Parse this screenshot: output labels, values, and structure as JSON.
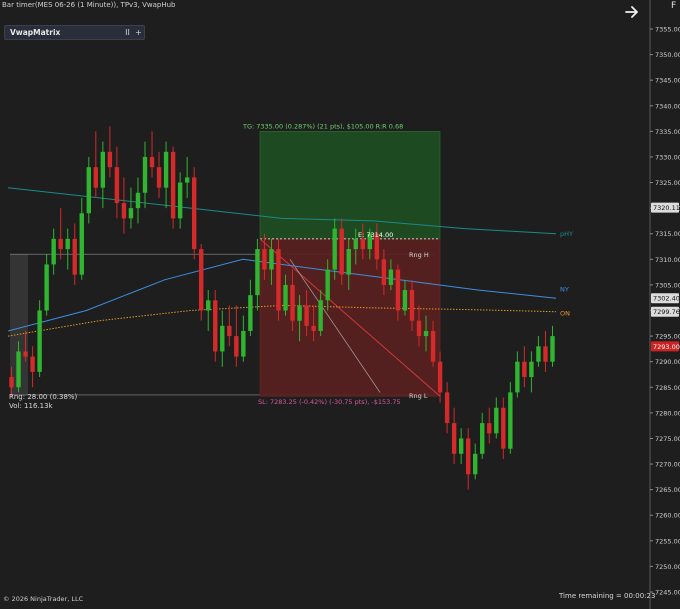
{
  "header": {
    "title": "Bar timer(MES 06-26 (1 Minute)), TPv3, VwapHub"
  },
  "panel": {
    "title": "VwapMatrix",
    "pause_label": "II",
    "add_label": "+"
  },
  "toolbar": {
    "arrow_icon": "arrow-right-icon",
    "f_label": "F"
  },
  "info": {
    "range": "Rng: 28.00 (0.38%)",
    "volume": "Vol: 116.13k"
  },
  "footer": {
    "copyright": "© 2026 NinjaTrader, LLC",
    "time_remaining": "Time remaining = 00:00:23"
  },
  "chart_data": {
    "type": "candlestick",
    "symbol": "MES 06-26",
    "interval": "1 Minute",
    "ylim": [
      7240,
      7360
    ],
    "ticks": [
      7245,
      7250,
      7255,
      7260,
      7265,
      7270,
      7275,
      7280,
      7285,
      7290,
      7295,
      7300,
      7305,
      7310,
      7315,
      7320,
      7325,
      7330,
      7335,
      7340,
      7345,
      7350,
      7355
    ],
    "tick_labels": [
      "7245.00",
      "7250.00",
      "7255.00",
      "7260.00",
      "7265.00",
      "7270.00",
      "7275.00",
      "7280.00",
      "7285.00",
      "7290.00",
      "7295.00",
      "7300.00",
      "7305.00",
      "7310.00",
      "7315.00",
      "7320.00",
      "7325.00",
      "7330.00",
      "7335.00",
      "7340.00",
      "7345.00",
      "7350.00",
      "7355.00"
    ],
    "colors": {
      "up": "#2fb52f",
      "down": "#d42a2a",
      "target": "#1f4d23",
      "stop": "#5a1f1f"
    },
    "candles": [
      [
        7287,
        7289,
        7283,
        7285
      ],
      [
        7285,
        7294,
        7284,
        7292
      ],
      [
        7292,
        7296,
        7290,
        7291
      ],
      [
        7291,
        7293,
        7285,
        7288
      ],
      [
        7288,
        7302,
        7287,
        7300
      ],
      [
        7300,
        7311,
        7299,
        7309
      ],
      [
        7309,
        7316,
        7307,
        7314
      ],
      [
        7314,
        7320,
        7310,
        7312
      ],
      [
        7312,
        7316,
        7308,
        7314
      ],
      [
        7314,
        7317,
        7305,
        7307
      ],
      [
        7307,
        7322,
        7306,
        7319
      ],
      [
        7319,
        7330,
        7317,
        7328
      ],
      [
        7328,
        7335,
        7322,
        7324
      ],
      [
        7324,
        7333,
        7320,
        7331
      ],
      [
        7331,
        7336,
        7326,
        7328
      ],
      [
        7328,
        7332,
        7318,
        7321
      ],
      [
        7321,
        7326,
        7315,
        7318
      ],
      [
        7318,
        7324,
        7316,
        7320
      ],
      [
        7320,
        7326,
        7317,
        7323
      ],
      [
        7323,
        7333,
        7320,
        7330
      ],
      [
        7330,
        7335,
        7326,
        7328
      ],
      [
        7328,
        7331,
        7322,
        7324
      ],
      [
        7324,
        7333,
        7320,
        7331
      ],
      [
        7331,
        7332,
        7316,
        7318
      ],
      [
        7318,
        7327,
        7316,
        7325
      ],
      [
        7325,
        7330,
        7322,
        7326
      ],
      [
        7326,
        7328,
        7310,
        7312
      ],
      [
        7312,
        7313,
        7298,
        7300
      ],
      [
        7300,
        7304,
        7296,
        7302
      ],
      [
        7302,
        7304,
        7290,
        7292
      ],
      [
        7292,
        7300,
        7289,
        7297
      ],
      [
        7297,
        7301,
        7293,
        7295
      ],
      [
        7295,
        7301,
        7289,
        7291
      ],
      [
        7291,
        7299,
        7290,
        7296
      ],
      [
        7296,
        7306,
        7295,
        7303
      ],
      [
        7303,
        7314,
        7300,
        7312
      ],
      [
        7312,
        7315,
        7306,
        7308
      ],
      [
        7308,
        7314,
        7305,
        7312
      ],
      [
        7312,
        7314,
        7298,
        7300
      ],
      [
        7300,
        7307,
        7299,
        7305
      ],
      [
        7305,
        7308,
        7296,
        7298
      ],
      [
        7298,
        7303,
        7294,
        7301
      ],
      [
        7301,
        7304,
        7295,
        7297
      ],
      [
        7297,
        7301,
        7294,
        7296
      ],
      [
        7296,
        7304,
        7295,
        7302
      ],
      [
        7302,
        7310,
        7300,
        7308
      ],
      [
        7308,
        7318,
        7306,
        7316
      ],
      [
        7316,
        7318,
        7305,
        7307
      ],
      [
        7307,
        7314,
        7304,
        7312
      ],
      [
        7312,
        7316,
        7309,
        7314
      ],
      [
        7314,
        7317,
        7310,
        7312
      ],
      [
        7312,
        7316,
        7310,
        7315
      ],
      [
        7315,
        7317,
        7308,
        7310
      ],
      [
        7310,
        7312,
        7303,
        7305
      ],
      [
        7305,
        7310,
        7304,
        7308
      ],
      [
        7308,
        7309,
        7298,
        7300
      ],
      [
        7300,
        7306,
        7299,
        7304
      ],
      [
        7304,
        7306,
        7296,
        7298
      ],
      [
        7298,
        7301,
        7293,
        7295
      ],
      [
        7295,
        7299,
        7292,
        7296
      ],
      [
        7296,
        7298,
        7289,
        7290
      ],
      [
        7290,
        7292,
        7282,
        7284
      ],
      [
        7284,
        7286,
        7276,
        7278
      ],
      [
        7278,
        7281,
        7270,
        7272
      ],
      [
        7272,
        7277,
        7270,
        7275
      ],
      [
        7275,
        7277,
        7265,
        7268
      ],
      [
        7268,
        7274,
        7267,
        7272
      ],
      [
        7272,
        7280,
        7271,
        7278
      ],
      [
        7278,
        7281,
        7274,
        7276
      ],
      [
        7276,
        7283,
        7275,
        7281
      ],
      [
        7281,
        7283,
        7271,
        7273
      ],
      [
        7273,
        7286,
        7272,
        7284
      ],
      [
        7284,
        7292,
        7283,
        7290
      ],
      [
        7290,
        7293,
        7285,
        7287
      ],
      [
        7287,
        7292,
        7284,
        7290
      ],
      [
        7290,
        7295,
        7289,
        7293
      ],
      [
        7293,
        7296,
        7288,
        7290
      ],
      [
        7290,
        7297,
        7289,
        7295
      ]
    ],
    "lines": [
      {
        "name": "pHY",
        "color": "#1b8a8a",
        "values": [
          7324,
          7322,
          7320,
          7318,
          7317.5,
          7316,
          7315
        ]
      },
      {
        "name": "NY",
        "color": "#3d8fe0",
        "values": [
          7296,
          7300,
          7306,
          7310,
          7308,
          7306,
          7304,
          7302.4
        ]
      },
      {
        "name": "ON",
        "color": "#e09a2a",
        "values": [
          7295,
          7298,
          7300,
          7301,
          7300.5,
          7300.2,
          7299.76
        ]
      }
    ],
    "price_labels": [
      {
        "label": "7320.11",
        "value": 7320.11,
        "bg": "#dcdcdc",
        "fg": "#111111"
      },
      {
        "label": "7302.40",
        "value": 7302.4,
        "bg": "#dcdcdc",
        "fg": "#111111"
      },
      {
        "label": "7299.76",
        "value": 7299.76,
        "bg": "#dcdcdc",
        "fg": "#111111"
      },
      {
        "label": "7293.00",
        "value": 7293.0,
        "bg": "#cc2222",
        "fg": "#ffffff"
      }
    ],
    "annotations": {
      "target_text": "TG: 7335.00 (0.287%) (21 pts), $105.00  R:R 0.68",
      "entry_text": "E: 7314.00",
      "stop_text": "SL: 7283.25 (-0.42%) (-30.75 pts), -$153.75",
      "range_high": "Rng H",
      "range_low": "Rng L",
      "line_labels": [
        "pHY",
        "NY",
        "ON"
      ],
      "target_price": 7335,
      "entry_price": 7314,
      "stop_price": 7283.25,
      "range_high_price": 7311,
      "range_low_price": 7283.5
    }
  }
}
